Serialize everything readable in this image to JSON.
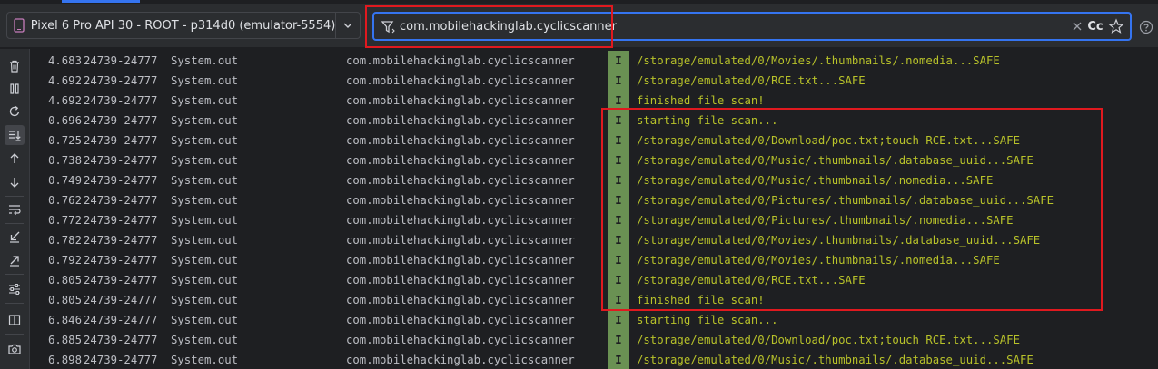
{
  "device": {
    "label": "Pixel 6 Pro API 30 - ROOT - p314d0 (emulator-5554)"
  },
  "filter": {
    "value": "com.mobilehackinglab.cyclicscanner",
    "case_label": "Cc"
  },
  "colors": {
    "accent": "#3574f0",
    "highlight": "#e0191f",
    "level_info_bg": "#6a9153",
    "message_text": "#b8c22a"
  },
  "sidebar": {
    "items": [
      {
        "name": "trash-icon"
      },
      {
        "name": "pause-icon"
      },
      {
        "name": "restart-icon"
      },
      {
        "name": "scroll-to-end-icon"
      },
      {
        "name": "arrow-up-icon"
      },
      {
        "name": "arrow-down-icon"
      },
      {
        "name": "soft-wrap-icon"
      },
      {
        "name": "collapse-icon"
      },
      {
        "name": "expand-icon"
      },
      {
        "name": "settings-sliders-icon"
      },
      {
        "name": "split-view-icon"
      },
      {
        "name": "camera-icon"
      }
    ]
  },
  "logs": [
    {
      "time": "4.683",
      "pid": "24739-24777",
      "tag": "System.out",
      "pkg": "com.mobilehackinglab.cyclicscanner",
      "level": "I",
      "msg": "/storage/emulated/0/Movies/.thumbnails/.nomedia...SAFE"
    },
    {
      "time": "4.692",
      "pid": "24739-24777",
      "tag": "System.out",
      "pkg": "com.mobilehackinglab.cyclicscanner",
      "level": "I",
      "msg": "/storage/emulated/0/RCE.txt...SAFE"
    },
    {
      "time": "4.692",
      "pid": "24739-24777",
      "tag": "System.out",
      "pkg": "com.mobilehackinglab.cyclicscanner",
      "level": "I",
      "msg": "finished file scan!"
    },
    {
      "time": "0.696",
      "pid": "24739-24777",
      "tag": "System.out",
      "pkg": "com.mobilehackinglab.cyclicscanner",
      "level": "I",
      "msg": "starting file scan..."
    },
    {
      "time": "0.725",
      "pid": "24739-24777",
      "tag": "System.out",
      "pkg": "com.mobilehackinglab.cyclicscanner",
      "level": "I",
      "msg": "/storage/emulated/0/Download/poc.txt;touch RCE.txt...SAFE"
    },
    {
      "time": "0.738",
      "pid": "24739-24777",
      "tag": "System.out",
      "pkg": "com.mobilehackinglab.cyclicscanner",
      "level": "I",
      "msg": "/storage/emulated/0/Music/.thumbnails/.database_uuid...SAFE"
    },
    {
      "time": "0.749",
      "pid": "24739-24777",
      "tag": "System.out",
      "pkg": "com.mobilehackinglab.cyclicscanner",
      "level": "I",
      "msg": "/storage/emulated/0/Music/.thumbnails/.nomedia...SAFE"
    },
    {
      "time": "0.762",
      "pid": "24739-24777",
      "tag": "System.out",
      "pkg": "com.mobilehackinglab.cyclicscanner",
      "level": "I",
      "msg": "/storage/emulated/0/Pictures/.thumbnails/.database_uuid...SAFE"
    },
    {
      "time": "0.772",
      "pid": "24739-24777",
      "tag": "System.out",
      "pkg": "com.mobilehackinglab.cyclicscanner",
      "level": "I",
      "msg": "/storage/emulated/0/Pictures/.thumbnails/.nomedia...SAFE"
    },
    {
      "time": "0.782",
      "pid": "24739-24777",
      "tag": "System.out",
      "pkg": "com.mobilehackinglab.cyclicscanner",
      "level": "I",
      "msg": "/storage/emulated/0/Movies/.thumbnails/.database_uuid...SAFE"
    },
    {
      "time": "0.792",
      "pid": "24739-24777",
      "tag": "System.out",
      "pkg": "com.mobilehackinglab.cyclicscanner",
      "level": "I",
      "msg": "/storage/emulated/0/Movies/.thumbnails/.nomedia...SAFE"
    },
    {
      "time": "0.805",
      "pid": "24739-24777",
      "tag": "System.out",
      "pkg": "com.mobilehackinglab.cyclicscanner",
      "level": "I",
      "msg": "/storage/emulated/0/RCE.txt...SAFE"
    },
    {
      "time": "0.805",
      "pid": "24739-24777",
      "tag": "System.out",
      "pkg": "com.mobilehackinglab.cyclicscanner",
      "level": "I",
      "msg": "finished file scan!"
    },
    {
      "time": "6.846",
      "pid": "24739-24777",
      "tag": "System.out",
      "pkg": "com.mobilehackinglab.cyclicscanner",
      "level": "I",
      "msg": "starting file scan..."
    },
    {
      "time": "6.885",
      "pid": "24739-24777",
      "tag": "System.out",
      "pkg": "com.mobilehackinglab.cyclicscanner",
      "level": "I",
      "msg": "/storage/emulated/0/Download/poc.txt;touch RCE.txt...SAFE"
    },
    {
      "time": "6.898",
      "pid": "24739-24777",
      "tag": "System.out",
      "pkg": "com.mobilehackinglab.cyclicscanner",
      "level": "I",
      "msg": "/storage/emulated/0/Music/.thumbnails/.database_uuid...SAFE"
    }
  ]
}
